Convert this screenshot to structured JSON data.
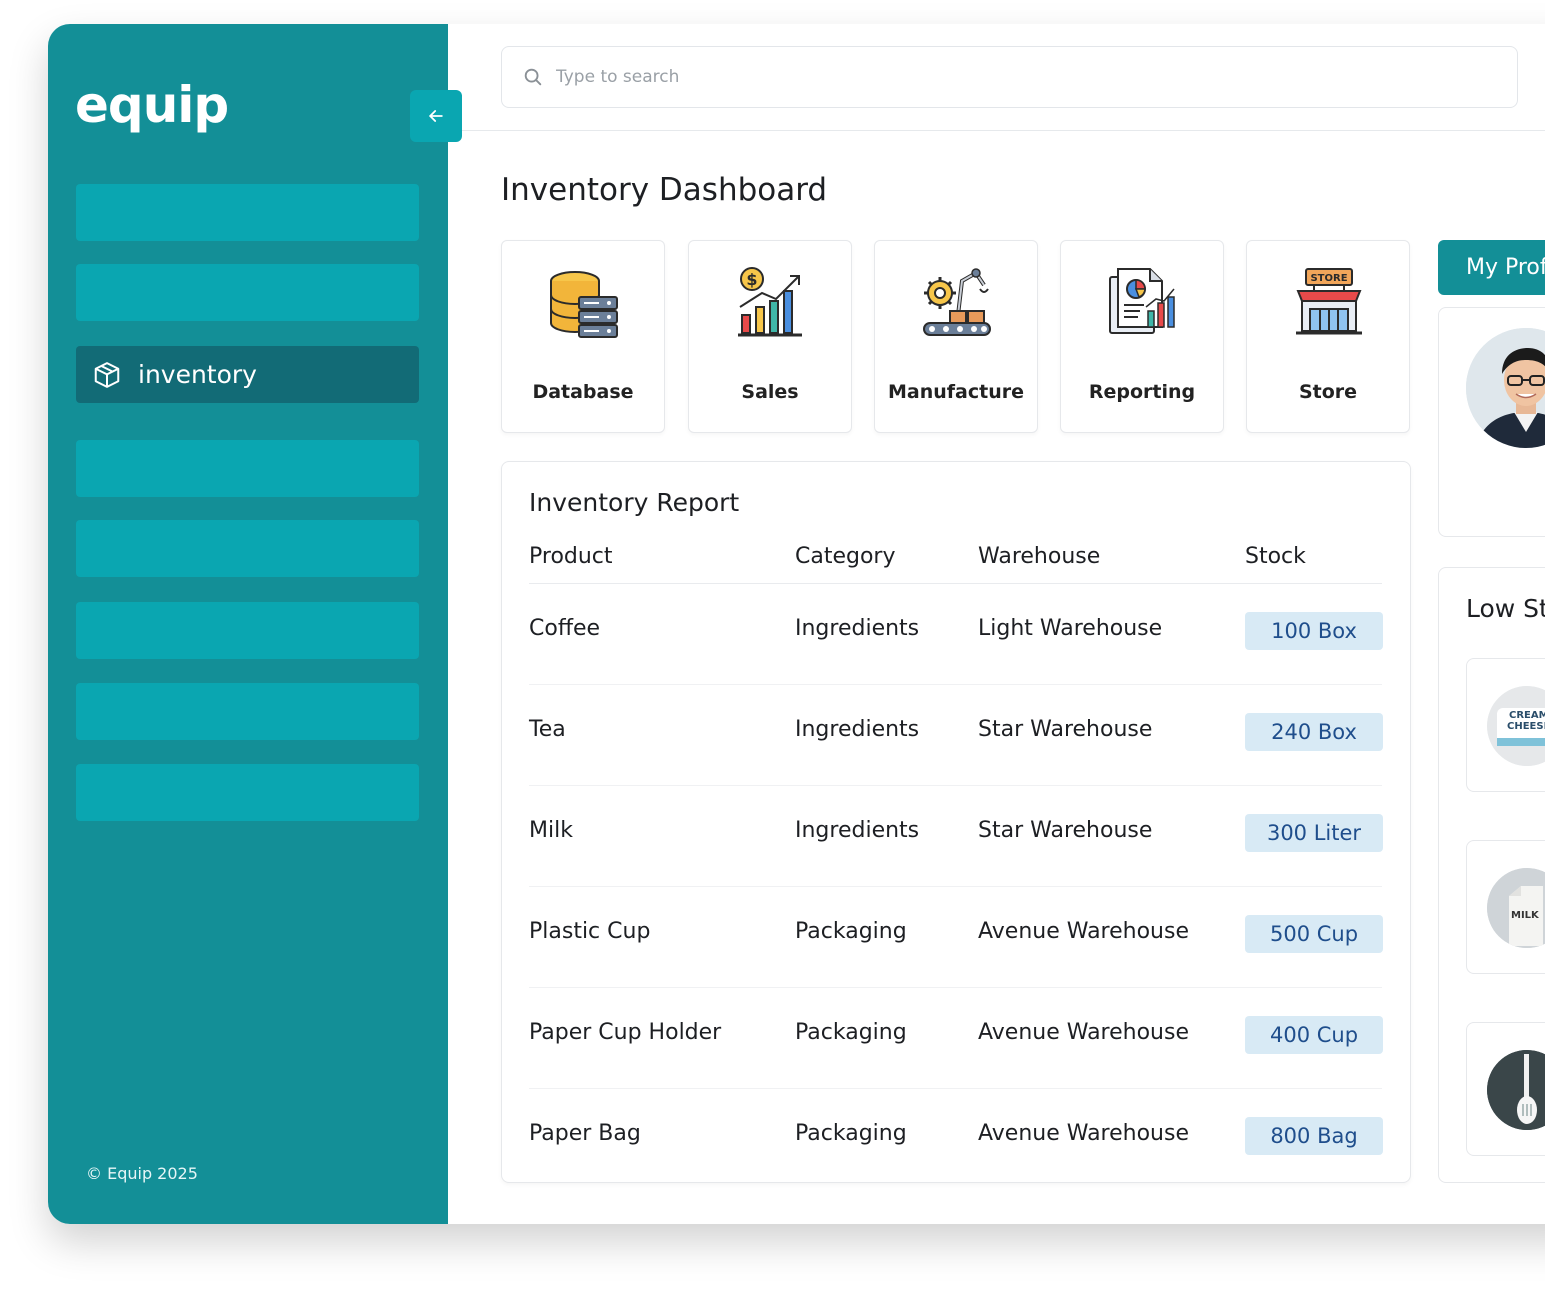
{
  "brand": {
    "logo_text": "equip",
    "copyright": "© Equip 2025"
  },
  "sidebar": {
    "items": [
      {
        "label": ""
      },
      {
        "label": ""
      },
      {
        "label": "inventory",
        "active": true
      },
      {
        "label": ""
      },
      {
        "label": ""
      },
      {
        "label": ""
      },
      {
        "label": ""
      },
      {
        "label": ""
      }
    ],
    "collapse_icon": "arrow-left-icon"
  },
  "search": {
    "placeholder": "Type to search",
    "value": ""
  },
  "page": {
    "title": "Inventory Dashboard"
  },
  "quick_links": [
    {
      "label": "Database",
      "icon": "database-icon"
    },
    {
      "label": "Sales",
      "icon": "sales-chart-icon"
    },
    {
      "label": "Manufacture",
      "icon": "factory-robot-icon"
    },
    {
      "label": "Reporting",
      "icon": "report-document-icon"
    },
    {
      "label": "Store",
      "icon": "store-icon"
    }
  ],
  "report": {
    "title": "Inventory Report",
    "columns": [
      "Product",
      "Category",
      "Warehouse",
      "Stock"
    ],
    "rows": [
      {
        "product": "Coffee",
        "category": "Ingredients",
        "warehouse": "Light Warehouse",
        "stock": "100 Box"
      },
      {
        "product": "Tea",
        "category": "Ingredients",
        "warehouse": "Star Warehouse",
        "stock": "240 Box"
      },
      {
        "product": "Milk",
        "category": "Ingredients",
        "warehouse": "Star Warehouse",
        "stock": "300 Liter"
      },
      {
        "product": "Plastic Cup",
        "category": "Packaging",
        "warehouse": "Avenue Warehouse",
        "stock": "500 Cup"
      },
      {
        "product": "Paper Cup Holder",
        "category": "Packaging",
        "warehouse": "Avenue Warehouse",
        "stock": "400 Cup"
      },
      {
        "product": "Paper Bag",
        "category": "Packaging",
        "warehouse": "Avenue Warehouse",
        "stock": "800 Bag"
      }
    ]
  },
  "profile": {
    "button_label": "My Prof"
  },
  "low_stock": {
    "title": "Low St",
    "items": [
      {
        "thumb_text_1": "CREAM",
        "thumb_text_2": "CHEESE"
      },
      {
        "thumb_text_1": "MILK"
      },
      {
        "thumb_text_1": ""
      }
    ]
  },
  "colors": {
    "sidebar_bg": "#138f97",
    "sidebar_item": "#0aa6b1",
    "sidebar_active": "#126b76",
    "stock_badge_bg": "#d8eaf5",
    "stock_badge_text": "#1f4e8c"
  }
}
